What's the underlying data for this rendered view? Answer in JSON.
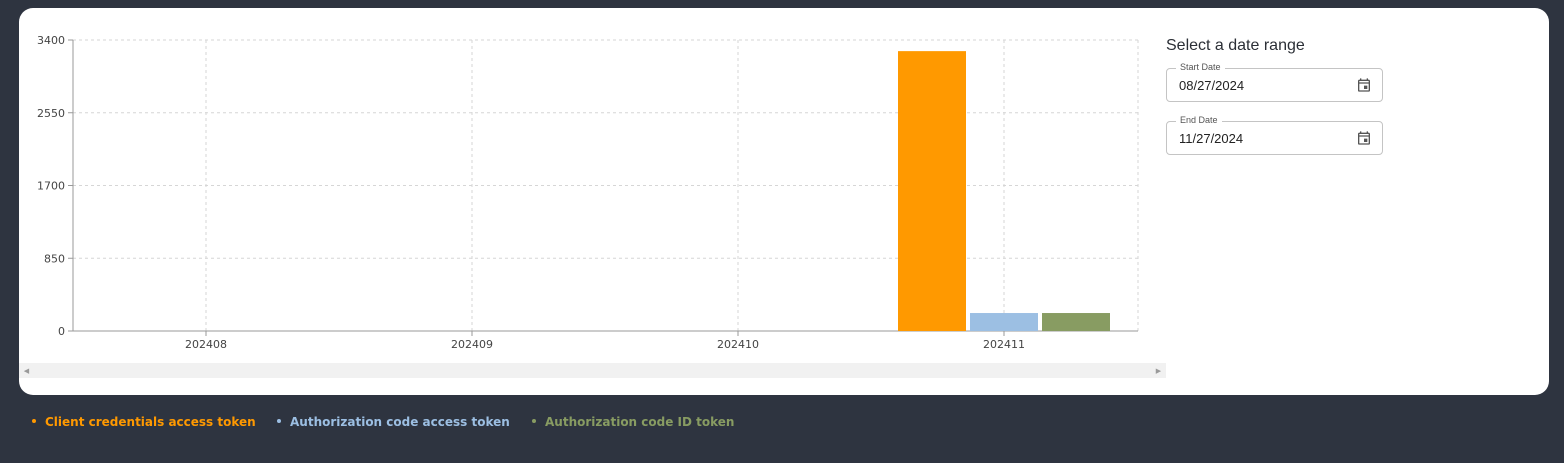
{
  "chart_data": {
    "type": "bar",
    "categories": [
      "202408",
      "202409",
      "202410",
      "202411"
    ],
    "series": [
      {
        "name": "Client credentials access token",
        "color": "#ff9900",
        "values": [
          0,
          0,
          0,
          3270
        ]
      },
      {
        "name": "Authorization code access token",
        "color": "#9cbfe3",
        "values": [
          0,
          0,
          0,
          210
        ]
      },
      {
        "name": "Authorization code ID token",
        "color": "#889c62",
        "values": [
          0,
          0,
          0,
          210
        ]
      }
    ],
    "yticks": [
      0,
      850,
      1700,
      2550,
      3400
    ],
    "ylim": [
      0,
      3400
    ],
    "grid": true,
    "grid_style": "dashed",
    "legend_position": "bottom-left"
  },
  "range_panel": {
    "title": "Select a date range",
    "start": {
      "label": "Start Date",
      "value": "08/27/2024"
    },
    "end": {
      "label": "End Date",
      "value": "11/27/2024"
    }
  },
  "icons": {
    "calendar": "calendar-icon",
    "scroll_left": "chevron-left-icon",
    "scroll_right": "chevron-right-icon"
  }
}
